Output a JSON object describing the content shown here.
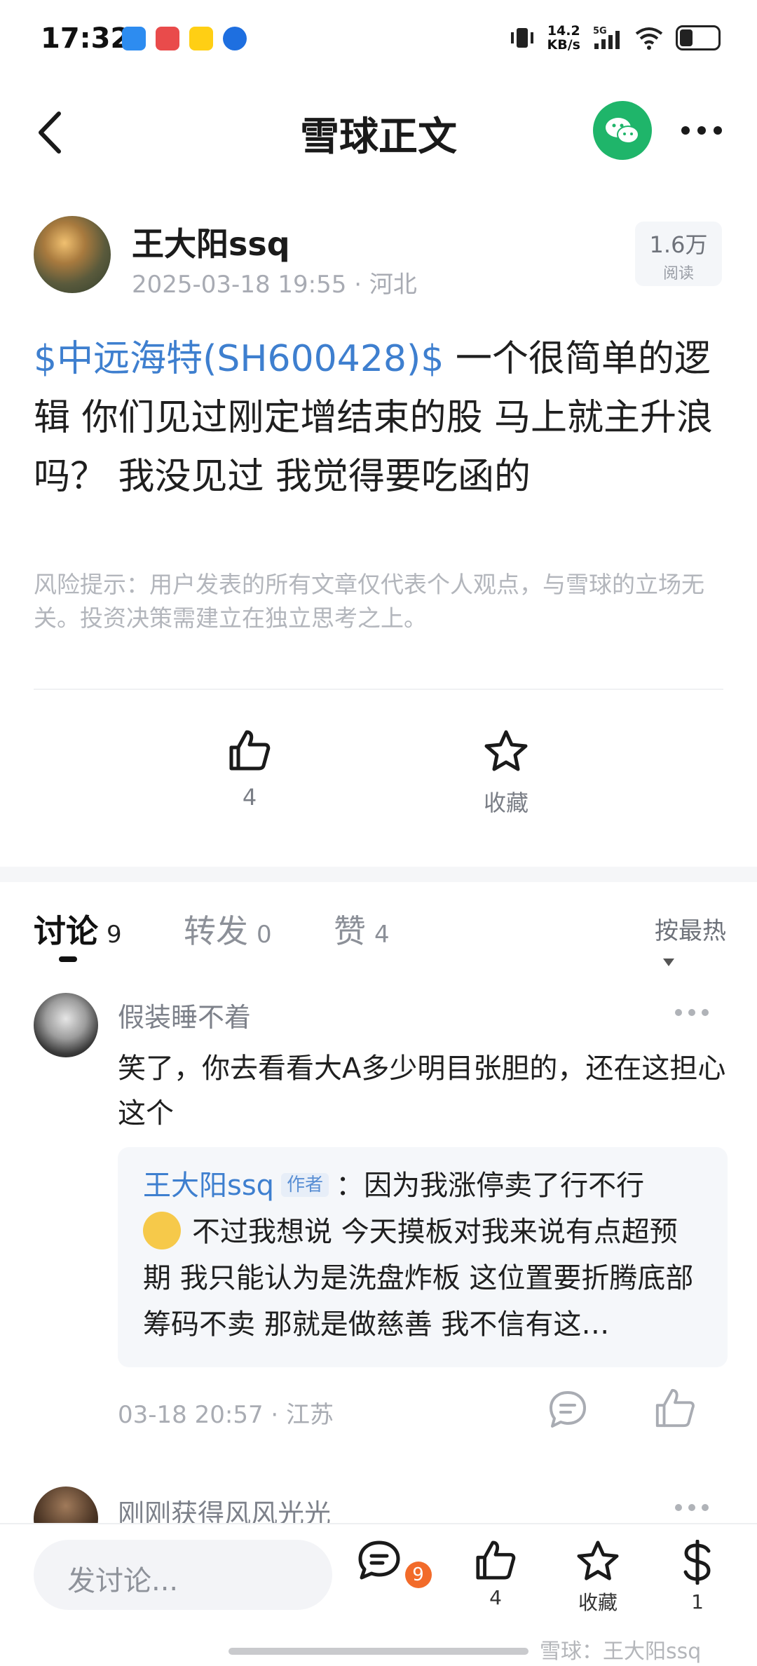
{
  "status_bar": {
    "time": "17:32",
    "net_speed_top": "14.2",
    "net_speed_bottom": "KB/s",
    "network": "5G"
  },
  "header": {
    "title": "雪球正文"
  },
  "author": {
    "name": "王大阳ssq",
    "datetime": "2025-03-18 19:55",
    "location": "河北",
    "separator": " · "
  },
  "reads": {
    "count": "1.6万",
    "label": "阅读"
  },
  "post": {
    "stock_link": "$中远海特(SH600428)$",
    "text": " 一个很简单的逻辑 你们见过刚定增结束的股 马上就主升浪吗？ 我没见过 我觉得要吃函的"
  },
  "disclaimer": "风险提示：用户发表的所有文章仅代表个人观点，与雪球的立场无关。投资决策需建立在独立思考之上。",
  "actions": {
    "like_count": "4",
    "favorite_label": "收藏"
  },
  "tabs": [
    {
      "label": "讨论",
      "count": "9"
    },
    {
      "label": "转发",
      "count": "0"
    },
    {
      "label": "赞",
      "count": "4"
    }
  ],
  "sort": {
    "label": "按最热"
  },
  "comment1": {
    "user": "假装睡不着",
    "text": "笑了，你去看看大A多少明目张胆的，还在这担心这个",
    "reply": {
      "author": "王大阳ssq",
      "tag": "作者",
      "text_first": "：因为我涨停卖了行不行",
      "text_rest": "不过我想说 今天摸板对我来说有点超预期 我只能认为是洗盘炸板 这位置要折腾底部筹码不卖 那就是做慈善 我不信有这…"
    },
    "time": "03-18 20:57",
    "location": "江苏",
    "separator": " · "
  },
  "comment2": {
    "user": "刚刚获得风风光光"
  },
  "bottom_bar": {
    "input_placeholder": "发讨论...",
    "comment_badge": "9",
    "like_count": "4",
    "favorite_label": "收藏",
    "reward_count": "1"
  },
  "watermark": "雪球：王大阳ssq",
  "colors": {
    "accent_blue": "#3e7fcf",
    "wechat_green": "#1fb56a",
    "badge_orange": "#f26b2a"
  }
}
